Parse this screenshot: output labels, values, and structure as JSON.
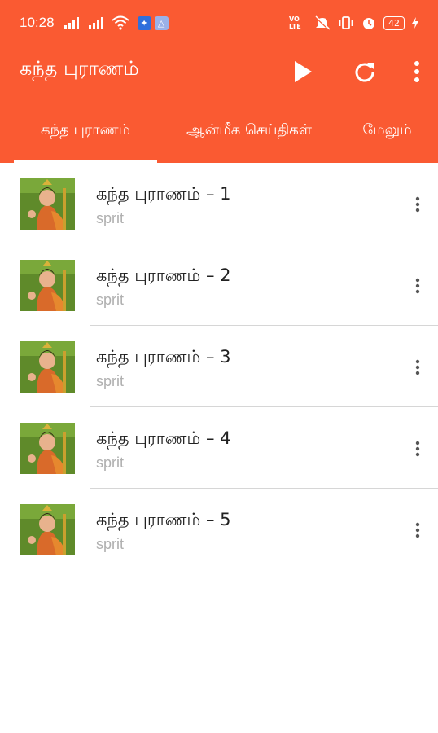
{
  "status_bar": {
    "time": "10:28",
    "volte": "VO LTE",
    "battery": "42"
  },
  "app_bar": {
    "title": "கந்த புராணம்",
    "icons": [
      "play-icon",
      "refresh-icon",
      "overflow-menu-icon"
    ]
  },
  "tabs": [
    {
      "label": "கந்த புராணம்",
      "active": true
    },
    {
      "label": "ஆன்மீக செய்திகள்",
      "active": false
    },
    {
      "label": "மேலும்",
      "active": false
    }
  ],
  "colors": {
    "primary": "#fa5a32",
    "title_text": "#212121",
    "subtitle_text": "#b0b0b0"
  },
  "tracks": [
    {
      "title": "கந்த புராணம் – 1",
      "subtitle": "sprit"
    },
    {
      "title": "கந்த புராணம் – 2",
      "subtitle": "sprit"
    },
    {
      "title": "கந்த புராணம் – 3",
      "subtitle": "sprit"
    },
    {
      "title": "கந்த புராணம் – 4",
      "subtitle": "sprit"
    },
    {
      "title": "கந்த புராணம் – 5",
      "subtitle": "sprit"
    }
  ]
}
